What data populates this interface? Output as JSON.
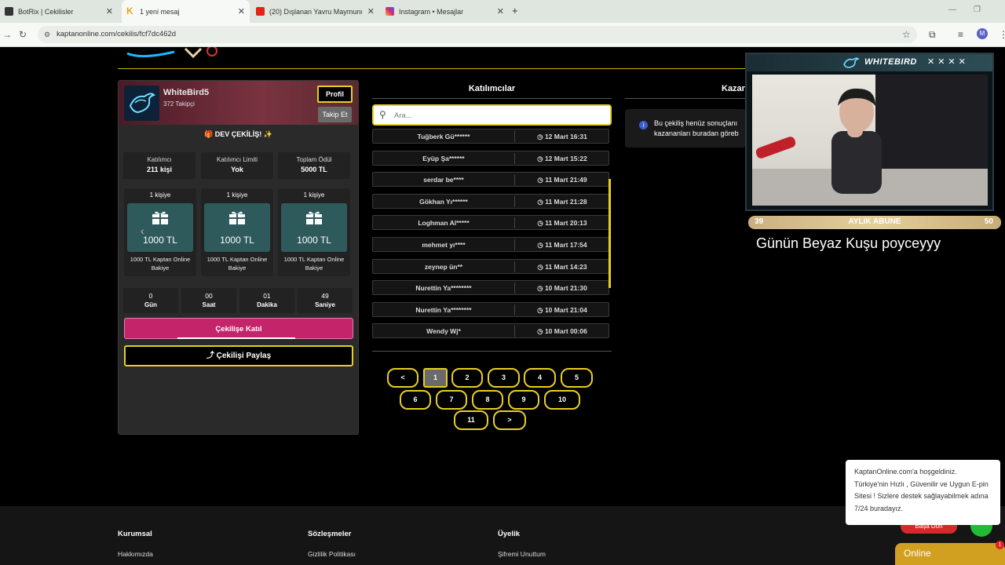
{
  "browser": {
    "tabs": [
      {
        "title": "BotRix | Cekilisler"
      },
      {
        "title": "1 yeni mesaj"
      },
      {
        "title": "(20) Dışlanan Yavru Maymunun"
      },
      {
        "title": "Instagram • Mesajlar"
      }
    ],
    "url": "kaptanonline.com/cekilis/fcf7dc462d",
    "profile_initial": "M"
  },
  "streamer": {
    "username": "WhiteBird5",
    "followers": "372 Takipçi",
    "profile_label": "Profil",
    "follow_label": "Takip Et"
  },
  "giveaway": {
    "title": "🎁 DEV ÇEKİLİŞ! ✨",
    "stats": [
      {
        "label": "Katılımcı",
        "value": "211 kişi"
      },
      {
        "label": "Katılımcı Limiti",
        "value": "Yok"
      },
      {
        "label": "Toplam Ödül",
        "value": "5000 TL"
      }
    ],
    "prizes": [
      {
        "count": "1 kişiye",
        "amount": "1000 TL",
        "desc1": "1000 TL Kaptan Online",
        "desc2": "Bakiye"
      },
      {
        "count": "1 kişiye",
        "amount": "1000 TL",
        "desc1": "1000 TL Kaptan Online",
        "desc2": "Bakiye"
      },
      {
        "count": "1 kişiye",
        "amount": "1000 TL",
        "desc1": "1000 TL Kaptan Online",
        "desc2": "Bakiye"
      }
    ],
    "countdown": [
      {
        "value": "0",
        "label": "Gün"
      },
      {
        "value": "00",
        "label": "Saat"
      },
      {
        "value": "01",
        "label": "Dakika"
      },
      {
        "value": "49",
        "label": "Saniye"
      }
    ],
    "join_label": "Çekilişe Katıl",
    "share_label": "Çekilişi Paylaş"
  },
  "participants": {
    "title": "Katılımcılar",
    "search_placeholder": "Ara...",
    "rows": [
      {
        "name": "Tuğberk Gü******",
        "time": "12 Mart 16:31"
      },
      {
        "name": "Eyüp Şa******",
        "time": "12 Mart 15:22"
      },
      {
        "name": "serdar be****",
        "time": "11 Mart 21:49"
      },
      {
        "name": "Gökhan Yı******",
        "time": "11 Mart 21:28"
      },
      {
        "name": "Loghman Al*****",
        "time": "11 Mart 20:13"
      },
      {
        "name": "mehmet yı****",
        "time": "11 Mart 17:54"
      },
      {
        "name": "zeynep ün**",
        "time": "11 Mart 14:23"
      },
      {
        "name": "Nurettin Ya********",
        "time": "10 Mart 21:30"
      },
      {
        "name": "Nurettin Ya********",
        "time": "10 Mart 21:04"
      },
      {
        "name": "Wendy Wj*",
        "time": "10 Mart 00:06"
      }
    ],
    "pagination": [
      "<",
      "1",
      "2",
      "3",
      "4",
      "5",
      "6",
      "7",
      "8",
      "9",
      "10",
      "11",
      ">"
    ]
  },
  "winners": {
    "title": "Kazan",
    "info_line1": "Bu çekiliş henüz sonuçlanı",
    "info_line2": "kazananları buradan göreb"
  },
  "overlay": {
    "brand": "WHITEBIRD",
    "controls": "✕✕✕✕",
    "sub_left": "39",
    "sub_label": "AYLIK ABUNE",
    "sub_right": "50",
    "day_text": "Günün Beyaz Kuşu poyceyyy"
  },
  "welcome": {
    "text": "KaptanOnline.com'a hoşgeldiniz. Türkiye'nin Hızlı , Güvenilir ve Uygun E-pin Sitesi ! Sizlere destek sağlayabilmek adına 7/24 buradayız.",
    "back_label": "Başa Dön"
  },
  "footer": {
    "cols": [
      {
        "heading": "Kurumsal",
        "link": "Hakkımızda"
      },
      {
        "heading": "Sözleşmeler",
        "link": "Gizlilik Politikası"
      },
      {
        "heading": "Üyelik",
        "link": "Şifremi Unuttum"
      }
    ],
    "online_label": "Online",
    "notif_count": "1"
  },
  "colors": {
    "accent": "#e7cf23",
    "join": "#c3246a",
    "prize_bg": "#2f5a5c",
    "chrome": "#dfe6df"
  }
}
